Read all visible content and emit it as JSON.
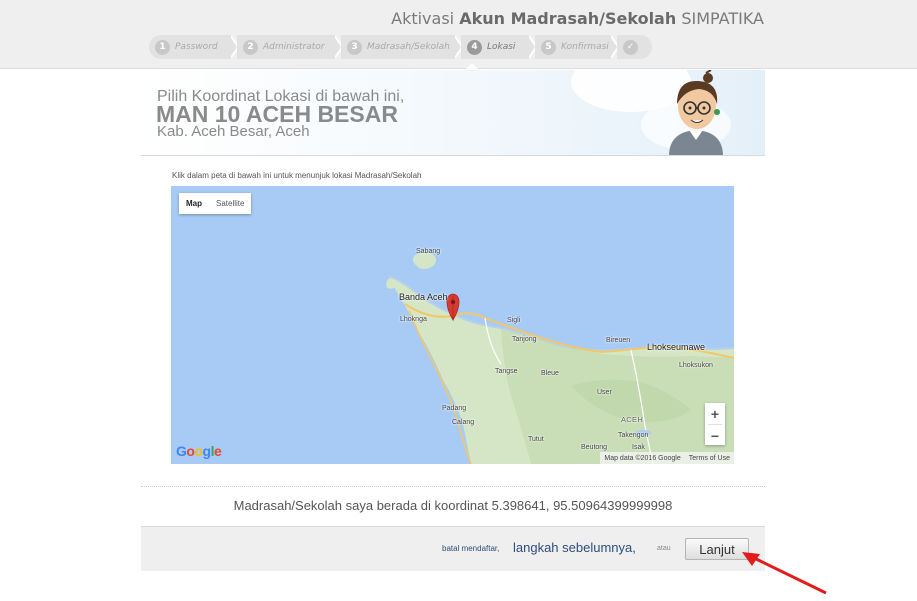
{
  "header": {
    "title_prefix": "Aktivasi",
    "title_bold": "Akun Madrasah/Sekolah",
    "title_suffix": "SIMPATIKA"
  },
  "steps": [
    {
      "num": "1",
      "label": "Password"
    },
    {
      "num": "2",
      "label": "Administrator"
    },
    {
      "num": "3",
      "label": "Madrasah/Sekolah"
    },
    {
      "num": "4",
      "label": "Lokasi",
      "active": true
    },
    {
      "num": "5",
      "label": "Konfirmasi"
    },
    {
      "num": "✓",
      "label": ""
    }
  ],
  "banner": {
    "line1": "Pilih Koordinat Lokasi di bawah ini,",
    "school_name": "MAN 10 ACEH BESAR",
    "region": "Kab. Aceh Besar, Aceh"
  },
  "map_section": {
    "instruction": "Klik dalam peta di bawah ini untuk menunjuk lokasi Madrasah/Sekolah",
    "map_types": {
      "map": "Map",
      "satellite": "Satellite",
      "selected": "Map"
    },
    "zoom_in": "+",
    "zoom_out": "−",
    "google_logo": "Google",
    "attribution": "Map data ©2016 Google",
    "terms": "Terms of Use",
    "places": {
      "sabang": "Sabang",
      "banda_aceh": "Banda Aceh",
      "lhoknga": "Lhoknga",
      "sigli": "Sigli",
      "bireuen": "Bireuen",
      "lhokseumawe": "Lhokseumawe",
      "tanjong": "Tanjong",
      "tangse": "Tangse",
      "bleue": "Bleue",
      "lhoksukon": "Lhoksukon",
      "user": "User",
      "padang": "Padang",
      "calang": "Calang",
      "aceh": "ACEH",
      "takengon": "Takengon",
      "tutut": "Tutut",
      "beutong": "Beutong",
      "isak": "Isak"
    },
    "marker_color": "#d93a2f"
  },
  "coordinate": {
    "prefix": "Madrasah/Sekolah saya berada di koordinat",
    "value": "5.398641, 95.50964399999998"
  },
  "footer": {
    "cancel_label": "batal mendaftar,",
    "prev_label": "langkah sebelumnya,",
    "or_label": "atau",
    "next_label": "Lanjut"
  }
}
